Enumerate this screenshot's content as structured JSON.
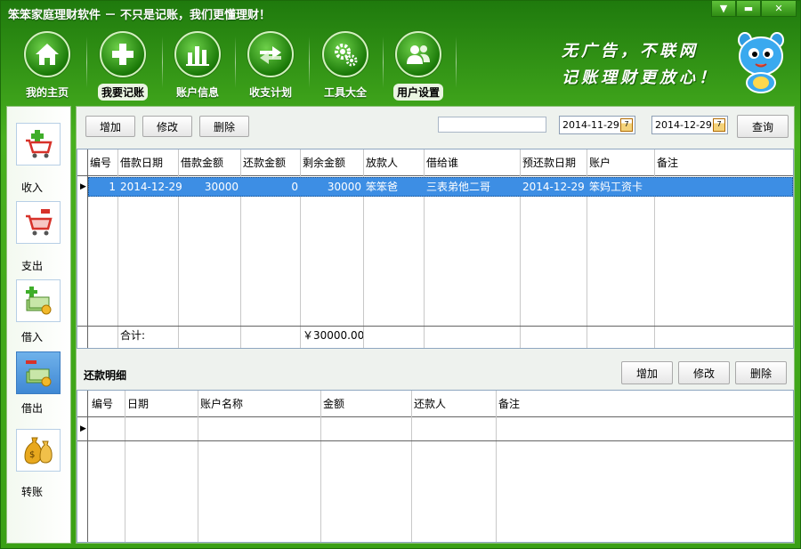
{
  "window": {
    "title": "笨笨家庭理财软件  － 不只是记账，我们更懂理财！",
    "minimize_glyph": "▼",
    "restore_glyph": "▬",
    "close_glyph": "✕"
  },
  "toolbar": {
    "items": [
      {
        "label": "我的主页",
        "icon": "home-icon"
      },
      {
        "label": "我要记账",
        "icon": "plus-icon",
        "selected": true
      },
      {
        "label": "账户信息",
        "icon": "bar-chart-icon"
      },
      {
        "label": "收支计划",
        "icon": "exchange-icon"
      },
      {
        "label": "工具大全",
        "icon": "gears-icon"
      },
      {
        "label": "用户设置",
        "icon": "users-icon"
      }
    ],
    "slogan_line1": "无广告，不联网",
    "slogan_line2": "记账理财更放心！"
  },
  "sidebar": {
    "items": [
      {
        "label": "收入",
        "icon": "cart-add-icon"
      },
      {
        "label": "支出",
        "icon": "cart-remove-icon"
      },
      {
        "label": "借入",
        "icon": "money-in-icon"
      },
      {
        "label": "借出",
        "icon": "money-out-icon",
        "active": true
      },
      {
        "label": "转账",
        "icon": "money-bags-icon"
      }
    ]
  },
  "top_actions": {
    "add": "增加",
    "edit": "修改",
    "delete": "删除",
    "search_value": "",
    "date_from": "2014-11-29",
    "date_to": "2014-12-29",
    "date_icon_digit": "7",
    "query": "查询"
  },
  "loan_table": {
    "columns": [
      "编号",
      "借款日期",
      "借款金额",
      "还款金额",
      "剩余金额",
      "放款人",
      "借给谁",
      "预还款日期",
      "账户",
      "备注"
    ],
    "rows": [
      {
        "id": "1",
        "date": "2014-12-29",
        "amount": "30000",
        "repaid": "0",
        "remaining": "30000",
        "lender": "笨笨爸",
        "borrower": "三表弟他二哥",
        "due_date": "2014-12-29",
        "account": "笨妈工资卡",
        "note": ""
      }
    ],
    "footer": {
      "label": "合计:",
      "remaining_total": "￥30000.00"
    },
    "row_marker": "▶"
  },
  "repay_section": {
    "title": "还款明细",
    "add": "增加",
    "edit": "修改",
    "delete": "删除",
    "columns": [
      "编号",
      "日期",
      "账户名称",
      "金额",
      "还款人",
      "备注"
    ],
    "row_marker": "▶"
  }
}
